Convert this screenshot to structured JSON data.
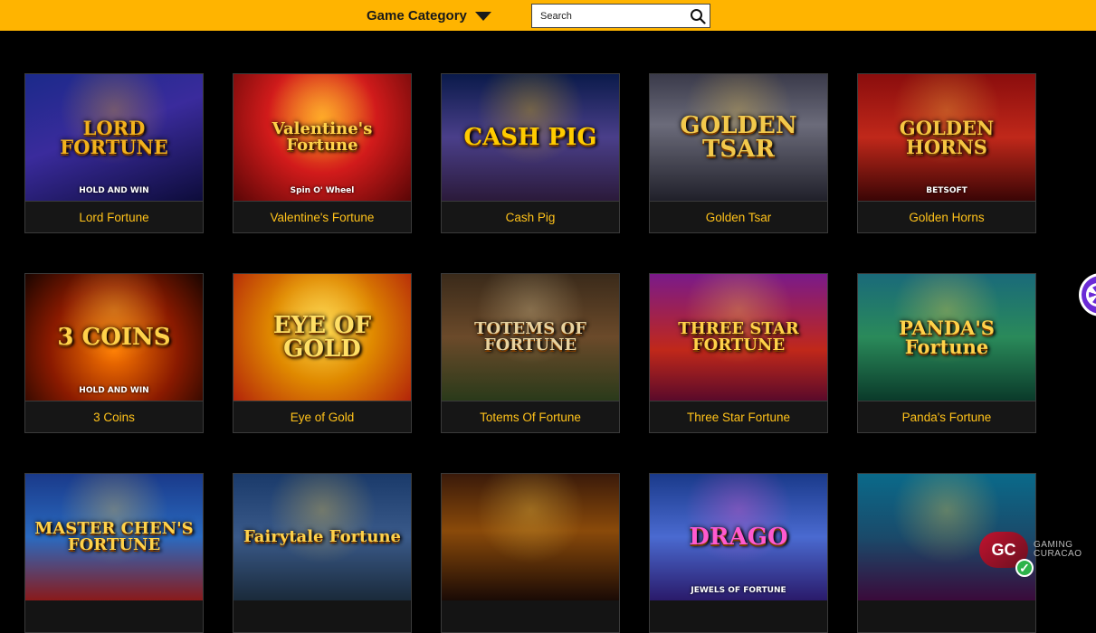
{
  "header": {
    "category_label": "Game Category",
    "search_placeholder": "Search"
  },
  "games": [
    {
      "name": "Lord Fortune",
      "art": "LORD FORTUNE",
      "sub": "HOLD AND WIN",
      "bg": "linear-gradient(160deg,#1b2a8a 0%,#3a2b9c 45%,#0d0c3a 100%)",
      "accent": "#f2b21d"
    },
    {
      "name": "Valentine's Fortune",
      "art": "Valentine's Fortune",
      "sub": "Spin O' Wheel",
      "bg": "radial-gradient(circle at 50% 35%,#ff9a1a 0%,#d21b1b 45%,#5a0606 100%)",
      "accent": "#ffd24a"
    },
    {
      "name": "Cash Pig",
      "art": "CASH PIG",
      "sub": "",
      "bg": "linear-gradient(180deg,#0a1a4a 0%,#4a3f8a 50%,#2b1a3a 100%)",
      "accent": "#ffcc00"
    },
    {
      "name": "Golden Tsar",
      "art": "GOLDEN TSAR",
      "sub": "",
      "bg": "linear-gradient(180deg,#3a3a4a 0%,#6b6b7a 40%,#20202a 100%)",
      "accent": "#f2c94c"
    },
    {
      "name": "Golden Horns",
      "art": "GOLDEN HORNS",
      "sub": "BETSOFT",
      "bg": "linear-gradient(180deg,#8a0d0d 0%,#c0281a 50%,#3a0505 100%)",
      "accent": "#f5c542"
    },
    {
      "name": "3 Coins",
      "art": "3 COINS",
      "sub": "HOLD AND WIN",
      "bg": "radial-gradient(circle at 50% 60%,#ff7a00 0%,#8a1a00 55%,#1a0500 100%)",
      "accent": "#ffd24a"
    },
    {
      "name": "Eye of Gold",
      "art": "EYE OF GOLD",
      "sub": "",
      "bg": "radial-gradient(circle at 50% 45%,#ffd84a 0%,#e08a00 45%,#b3240a 100%)",
      "accent": "#ffe066"
    },
    {
      "name": "Totems Of Fortune",
      "art": "TOTEMS OF FORTUNE",
      "sub": "",
      "bg": "linear-gradient(180deg,#3a2a1a 0%,#6b4a2a 50%,#2a3a1a 100%)",
      "accent": "#e8d3a0"
    },
    {
      "name": "Three Star Fortune",
      "art": "THREE STAR FORTUNE",
      "sub": "",
      "bg": "linear-gradient(180deg,#7a1a8a 0%,#c0281a 60%,#5a0a2a 100%)",
      "accent": "#ffd24a"
    },
    {
      "name": "Panda's Fortune",
      "art": "PANDA'S Fortune",
      "sub": "",
      "bg": "linear-gradient(180deg,#1a6a7a 0%,#2a8a5a 50%,#0a3a2a 100%)",
      "accent": "#ffd24a"
    },
    {
      "name": "",
      "art": "MASTER CHEN'S FORTUNE",
      "sub": "",
      "bg": "linear-gradient(180deg,#1a3a8a 0%,#2a6ac0 50%,#8a1a1a 100%)",
      "accent": "#ffd24a"
    },
    {
      "name": "",
      "art": "Fairytale Fortune",
      "sub": "",
      "bg": "linear-gradient(180deg,#1a3a6a 0%,#3a5a8a 50%,#1a2a3a 100%)",
      "accent": "#ffd24a"
    },
    {
      "name": "",
      "art": "",
      "sub": "",
      "bg": "linear-gradient(180deg,#3a1a0a 0%,#8a4a0a 45%,#1a0a05 100%)",
      "accent": "#ffd24a"
    },
    {
      "name": "",
      "art": "DRAGO",
      "sub": "JEWELS OF FORTUNE",
      "bg": "linear-gradient(180deg,#1a3a8a 0%,#4a6ad0 50%,#2a1a6a 100%)",
      "accent": "#ff5ad0"
    },
    {
      "name": "",
      "art": "",
      "sub": "",
      "bg": "linear-gradient(180deg,#0a6a8a 0%,#1a4a6a 50%,#3a0a3a 100%)",
      "accent": "#ffd24a"
    }
  ],
  "badge": {
    "logo": "GC",
    "line1": "GAMING",
    "line2": "CURACAO",
    "check": "✓"
  }
}
